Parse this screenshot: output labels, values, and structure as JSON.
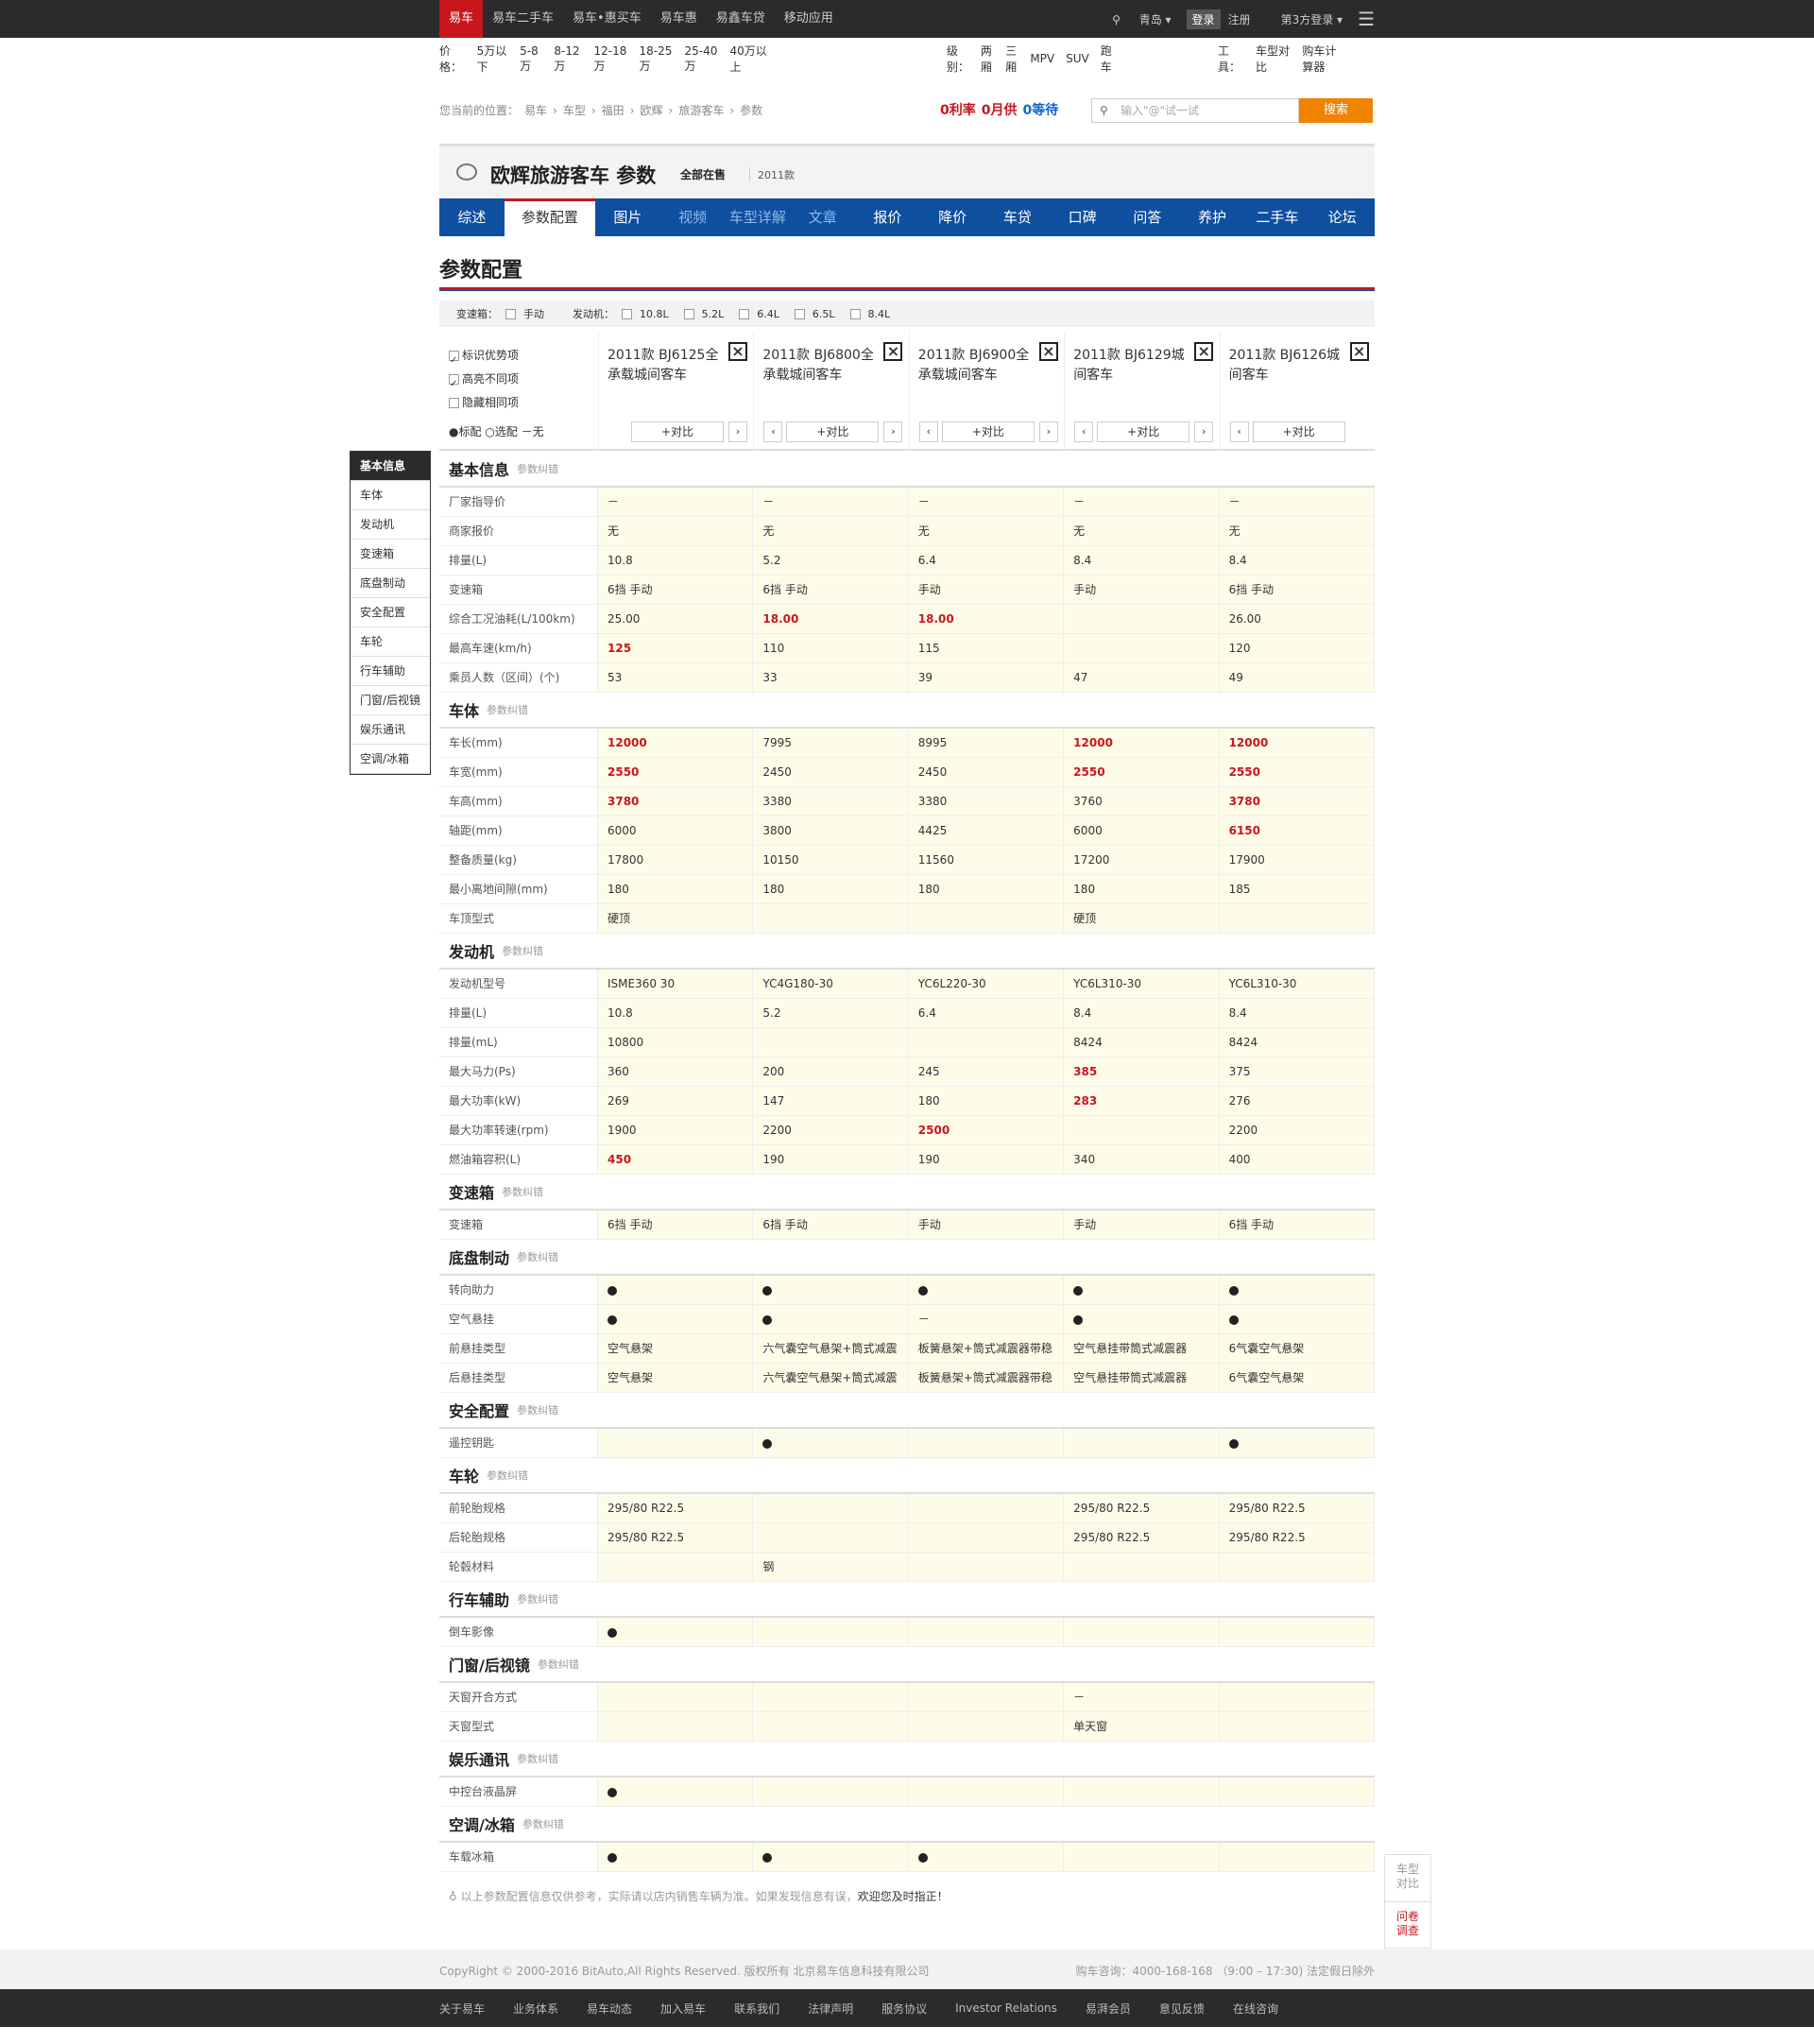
{
  "topnav": {
    "items": [
      "易车",
      "易车二手车",
      "易车•惠买车",
      "易车惠",
      "易鑫车贷",
      "移动应用"
    ],
    "city": "青岛",
    "login": "登录",
    "register": "注册",
    "third": "第3方登录"
  },
  "filter": {
    "price_label": "价格：",
    "prices": [
      "5万以下",
      "5-8万",
      "8-12万",
      "12-18万",
      "18-25万",
      "25-40万",
      "40万以上"
    ],
    "level_label": "级别：",
    "levels": [
      "两厢",
      "三厢",
      "MPV",
      "SUV",
      "跑车"
    ],
    "tools_label": "工具：",
    "tools": [
      "车型对比",
      "购车计算器"
    ]
  },
  "breadcrumb": [
    "您当前的位置：",
    "易车",
    "车型",
    "福田",
    "欧辉",
    "旅游客车",
    "参数"
  ],
  "promo": [
    "0利率",
    "0月供",
    "0等待"
  ],
  "search": {
    "placeholder": "输入\"@\"试一试",
    "button": "搜索"
  },
  "title": {
    "name": "欧辉旅游客车 参数",
    "sale": "全部在售",
    "year": "2011款"
  },
  "tabs": [
    "综述",
    "参数配置",
    "图片",
    "视频",
    "车型详解",
    "文章",
    "报价",
    "降价",
    "车贷",
    "口碑",
    "问答",
    "养护",
    "二手车",
    "论坛"
  ],
  "section_title": "参数配置",
  "subfilter": {
    "trans_label": "变速箱：",
    "trans": [
      "手动"
    ],
    "engine_label": "发动机：",
    "engines": [
      "10.8L",
      "5.2L",
      "6.4L",
      "6.5L",
      "8.4L"
    ]
  },
  "options": [
    "标识优势项",
    "高亮不同项",
    "隐藏相同项"
  ],
  "legend": "●标配 ○选配 －无",
  "cars": [
    {
      "name": "2011款 BJ6125全承载城间客车"
    },
    {
      "name": "2011款 BJ6800全承载城间客车"
    },
    {
      "name": "2011款 BJ6900全承载城间客车"
    },
    {
      "name": "2011款 BJ6129城间客车"
    },
    {
      "name": "2011款 BJ6126城间客车"
    }
  ],
  "compare_label": "+对比",
  "sidenav": [
    "基本信息",
    "车体",
    "发动机",
    "变速箱",
    "底盘制动",
    "安全配置",
    "车轮",
    "行车辅助",
    "门窗/后视镜",
    "娱乐通讯",
    "空调/冰箱"
  ],
  "correct_label": "参数纠错",
  "sections": [
    {
      "title": "基本信息",
      "rows": [
        {
          "label": "厂家指导价",
          "values": [
            "－",
            "－",
            "－",
            "－",
            "－"
          ]
        },
        {
          "label": "商家报价",
          "values": [
            "无",
            "无",
            "无",
            "无",
            "无"
          ]
        },
        {
          "label": "排量(L)",
          "values": [
            "10.8",
            "5.2",
            "6.4",
            "8.4",
            "8.4"
          ]
        },
        {
          "label": "变速箱",
          "values": [
            "6挡 手动",
            "6挡 手动",
            "手动",
            "手动",
            "6挡 手动"
          ]
        },
        {
          "label": "综合工况油耗(L/100km)",
          "values": [
            "25.00",
            "18.00",
            "18.00",
            "",
            "26.00"
          ],
          "red": [
            1,
            2
          ]
        },
        {
          "label": "最高车速(km/h)",
          "values": [
            "125",
            "110",
            "115",
            "",
            "120"
          ],
          "red": [
            0
          ]
        },
        {
          "label": "乘员人数（区间）(个)",
          "values": [
            "53",
            "33",
            "39",
            "47",
            "49"
          ]
        }
      ]
    },
    {
      "title": "车体",
      "rows": [
        {
          "label": "车长(mm)",
          "values": [
            "12000",
            "7995",
            "8995",
            "12000",
            "12000"
          ],
          "red": [
            0,
            3,
            4
          ]
        },
        {
          "label": "车宽(mm)",
          "values": [
            "2550",
            "2450",
            "2450",
            "2550",
            "2550"
          ],
          "red": [
            0,
            3,
            4
          ]
        },
        {
          "label": "车高(mm)",
          "values": [
            "3780",
            "3380",
            "3380",
            "3760",
            "3780"
          ],
          "red": [
            0,
            4
          ]
        },
        {
          "label": "轴距(mm)",
          "values": [
            "6000",
            "3800",
            "4425",
            "6000",
            "6150"
          ],
          "red": [
            4
          ]
        },
        {
          "label": "整备质量(kg)",
          "values": [
            "17800",
            "10150",
            "11560",
            "17200",
            "17900"
          ]
        },
        {
          "label": "最小离地间隙(mm)",
          "values": [
            "180",
            "180",
            "180",
            "180",
            "185"
          ]
        },
        {
          "label": "车顶型式",
          "values": [
            "硬顶",
            "",
            "",
            "硬顶",
            ""
          ]
        }
      ]
    },
    {
      "title": "发动机",
      "rows": [
        {
          "label": "发动机型号",
          "values": [
            "ISME360 30",
            "YC4G180-30",
            "YC6L220-30",
            "YC6L310-30",
            "YC6L310-30"
          ]
        },
        {
          "label": "排量(L)",
          "values": [
            "10.8",
            "5.2",
            "6.4",
            "8.4",
            "8.4"
          ]
        },
        {
          "label": "排量(mL)",
          "values": [
            "10800",
            "",
            "",
            "8424",
            "8424"
          ]
        },
        {
          "label": "最大马力(Ps)",
          "values": [
            "360",
            "200",
            "245",
            "385",
            "375"
          ],
          "red": [
            3
          ]
        },
        {
          "label": "最大功率(kW)",
          "values": [
            "269",
            "147",
            "180",
            "283",
            "276"
          ],
          "red": [
            3
          ]
        },
        {
          "label": "最大功率转速(rpm)",
          "values": [
            "1900",
            "2200",
            "2500",
            "",
            "2200"
          ],
          "red": [
            2
          ]
        },
        {
          "label": "燃油箱容积(L)",
          "values": [
            "450",
            "190",
            "190",
            "340",
            "400"
          ],
          "red": [
            0
          ]
        }
      ]
    },
    {
      "title": "变速箱",
      "rows": [
        {
          "label": "变速箱",
          "values": [
            "6挡 手动",
            "6挡 手动",
            "手动",
            "手动",
            "6挡 手动"
          ]
        }
      ]
    },
    {
      "title": "底盘制动",
      "rows": [
        {
          "label": "转向助力",
          "values": [
            "●",
            "●",
            "●",
            "●",
            "●"
          ]
        },
        {
          "label": "空气悬挂",
          "values": [
            "●",
            "●",
            "－",
            "●",
            "●"
          ]
        },
        {
          "label": "前悬挂类型",
          "values": [
            "空气悬架",
            "六气囊空气悬架+筒式减震",
            "板簧悬架+筒式减震器带稳",
            "空气悬挂带筒式减震器",
            "6气囊空气悬架"
          ]
        },
        {
          "label": "后悬挂类型",
          "values": [
            "空气悬架",
            "六气囊空气悬架+筒式减震",
            "板簧悬架+筒式减震器带稳",
            "空气悬挂带筒式减震器",
            "6气囊空气悬架"
          ]
        }
      ]
    },
    {
      "title": "安全配置",
      "rows": [
        {
          "label": "遥控钥匙",
          "values": [
            "",
            "●",
            "",
            "",
            "●"
          ]
        }
      ]
    },
    {
      "title": "车轮",
      "rows": [
        {
          "label": "前轮胎规格",
          "values": [
            "295/80 R22.5",
            "",
            "",
            "295/80 R22.5",
            "295/80 R22.5"
          ]
        },
        {
          "label": "后轮胎规格",
          "values": [
            "295/80 R22.5",
            "",
            "",
            "295/80 R22.5",
            "295/80 R22.5"
          ]
        },
        {
          "label": "轮毂材料",
          "values": [
            "",
            "钢",
            "",
            "",
            ""
          ]
        }
      ]
    },
    {
      "title": "行车辅助",
      "rows": [
        {
          "label": "倒车影像",
          "values": [
            "●",
            "",
            "",
            "",
            ""
          ]
        }
      ]
    },
    {
      "title": "门窗/后视镜",
      "rows": [
        {
          "label": "天窗开合方式",
          "values": [
            "",
            "",
            "",
            "－",
            ""
          ]
        },
        {
          "label": "天窗型式",
          "values": [
            "",
            "",
            "",
            "单天窗",
            ""
          ]
        }
      ]
    },
    {
      "title": "娱乐通讯",
      "rows": [
        {
          "label": "中控台液晶屏",
          "values": [
            "●",
            "",
            "",
            "",
            ""
          ]
        }
      ]
    },
    {
      "title": "空调/冰箱",
      "rows": [
        {
          "label": "车载冰箱",
          "values": [
            "●",
            "●",
            "●",
            "",
            ""
          ]
        }
      ]
    }
  ],
  "note": {
    "text": "以上参数配置信息仅供参考，实际请以店内销售车辆为准。如果发现信息有误，",
    "link": "欢迎您及时指正！"
  },
  "float": {
    "compare": "车型对比",
    "survey": "问卷调查"
  },
  "footer": {
    "copyright": "CopyRight © 2000-2016 BitAuto,All Rights Reserved. 版权所有 北京易车信息科技有限公司",
    "hotline": "购车咨询：4000-168-168 （9:00 – 17:30) 法定假日除外",
    "links": [
      "关于易车",
      "业务体系",
      "易车动态",
      "加入易车",
      "联系我们",
      "法律声明",
      "服务协议",
      "Investor Relations",
      "易湃会员",
      "意见反馈",
      "在线咨询"
    ]
  },
  "colors": {
    "red": "#c8161d",
    "blue": "#0f4fa0",
    "orange": "#f08300",
    "dark": "#2b2b2b",
    "cell_bg": "#fdfce8"
  }
}
